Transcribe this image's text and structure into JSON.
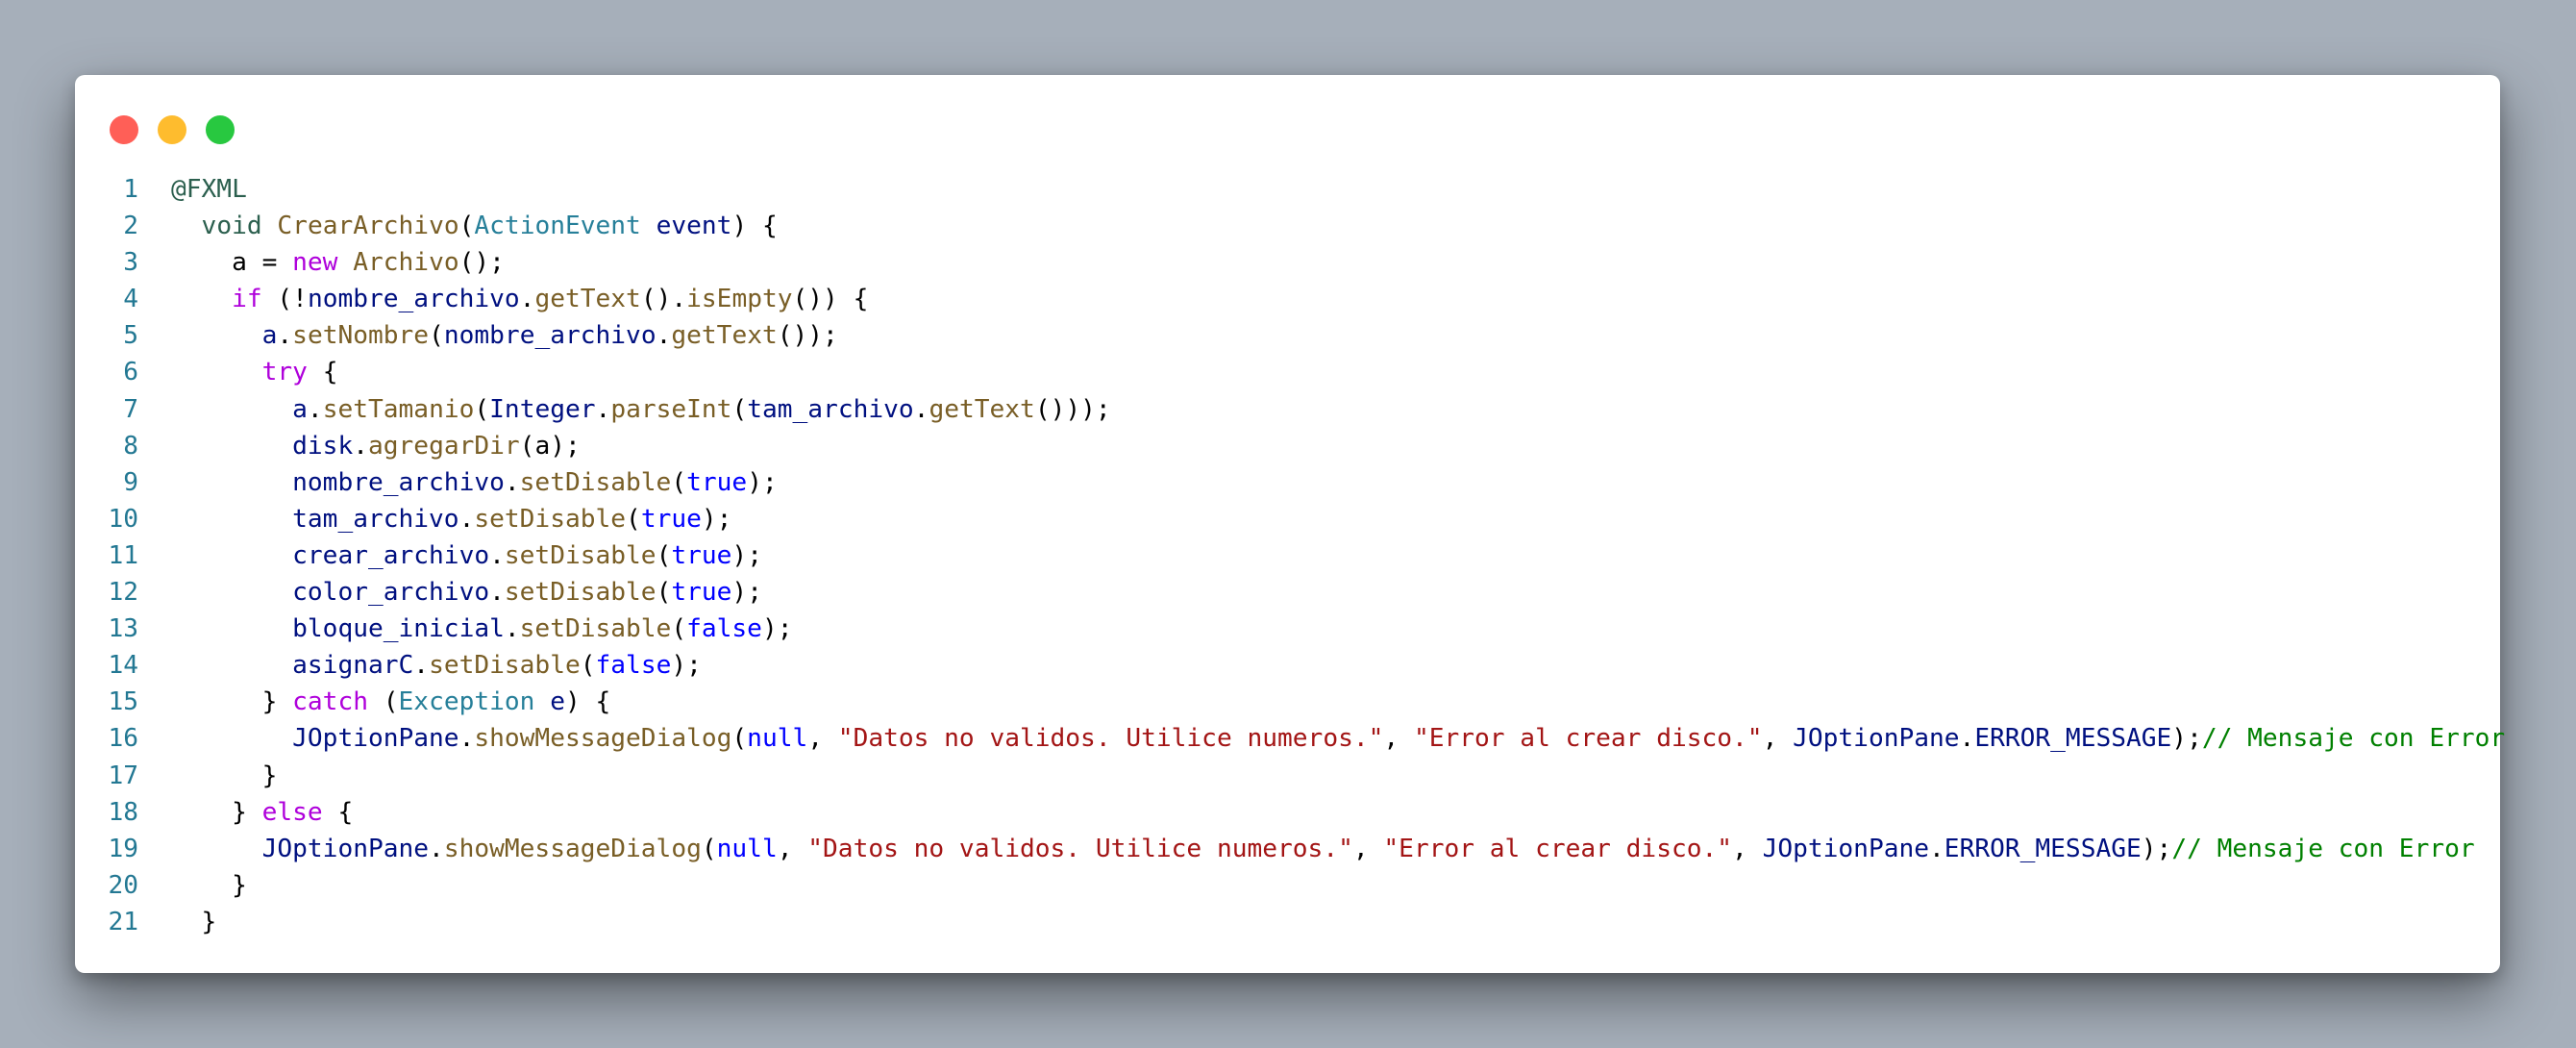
{
  "window": {
    "controls": [
      {
        "name": "close",
        "color": "#ff5f57"
      },
      {
        "name": "minimize",
        "color": "#febc2e"
      },
      {
        "name": "maximize",
        "color": "#28c840"
      }
    ]
  },
  "colors": {
    "annotation": "#2b5f4e",
    "keyword": "#0000ff",
    "control": "#af00db",
    "type": "#267f99",
    "function": "#795e26",
    "variable": "#001080",
    "string": "#a31515",
    "comment": "#008000",
    "line_number": "#237893"
  },
  "code": {
    "lines": [
      {
        "n": "1",
        "tokens": [
          [
            "ann",
            "@FXML"
          ]
        ]
      },
      {
        "n": "2",
        "tokens": [
          [
            "plain",
            "  "
          ],
          [
            "ann",
            "void"
          ],
          [
            "plain",
            " "
          ],
          [
            "fn",
            "CrearArchivo"
          ],
          [
            "plain",
            "("
          ],
          [
            "type",
            "ActionEvent"
          ],
          [
            "plain",
            " "
          ],
          [
            "var",
            "event"
          ],
          [
            "plain",
            ") {"
          ]
        ]
      },
      {
        "n": "3",
        "tokens": [
          [
            "plain",
            "    a = "
          ],
          [
            "ctl",
            "new"
          ],
          [
            "plain",
            " "
          ],
          [
            "fn",
            "Archivo"
          ],
          [
            "plain",
            "();"
          ]
        ]
      },
      {
        "n": "4",
        "tokens": [
          [
            "plain",
            "    "
          ],
          [
            "ctl",
            "if"
          ],
          [
            "plain",
            " (!"
          ],
          [
            "var",
            "nombre_archivo"
          ],
          [
            "plain",
            "."
          ],
          [
            "fn",
            "getText"
          ],
          [
            "plain",
            "()."
          ],
          [
            "fn",
            "isEmpty"
          ],
          [
            "plain",
            "()) {"
          ]
        ]
      },
      {
        "n": "5",
        "tokens": [
          [
            "plain",
            "      "
          ],
          [
            "var",
            "a"
          ],
          [
            "plain",
            "."
          ],
          [
            "fn",
            "setNombre"
          ],
          [
            "plain",
            "("
          ],
          [
            "var",
            "nombre_archivo"
          ],
          [
            "plain",
            "."
          ],
          [
            "fn",
            "getText"
          ],
          [
            "plain",
            "());"
          ]
        ]
      },
      {
        "n": "6",
        "tokens": [
          [
            "plain",
            "      "
          ],
          [
            "ctl",
            "try"
          ],
          [
            "plain",
            " {"
          ]
        ]
      },
      {
        "n": "7",
        "tokens": [
          [
            "plain",
            "        "
          ],
          [
            "var",
            "a"
          ],
          [
            "plain",
            "."
          ],
          [
            "fn",
            "setTamanio"
          ],
          [
            "plain",
            "("
          ],
          [
            "var",
            "Integer"
          ],
          [
            "plain",
            "."
          ],
          [
            "fn",
            "parseInt"
          ],
          [
            "plain",
            "("
          ],
          [
            "var",
            "tam_archivo"
          ],
          [
            "plain",
            "."
          ],
          [
            "fn",
            "getText"
          ],
          [
            "plain",
            "()));"
          ]
        ]
      },
      {
        "n": "8",
        "tokens": [
          [
            "plain",
            "        "
          ],
          [
            "var",
            "disk"
          ],
          [
            "plain",
            "."
          ],
          [
            "fn",
            "agregarDir"
          ],
          [
            "plain",
            "(a);"
          ]
        ]
      },
      {
        "n": "9",
        "tokens": [
          [
            "plain",
            "        "
          ],
          [
            "var",
            "nombre_archivo"
          ],
          [
            "plain",
            "."
          ],
          [
            "fn",
            "setDisable"
          ],
          [
            "plain",
            "("
          ],
          [
            "kw",
            "true"
          ],
          [
            "plain",
            ");"
          ]
        ]
      },
      {
        "n": "10",
        "tokens": [
          [
            "plain",
            "        "
          ],
          [
            "var",
            "tam_archivo"
          ],
          [
            "plain",
            "."
          ],
          [
            "fn",
            "setDisable"
          ],
          [
            "plain",
            "("
          ],
          [
            "kw",
            "true"
          ],
          [
            "plain",
            ");"
          ]
        ]
      },
      {
        "n": "11",
        "tokens": [
          [
            "plain",
            "        "
          ],
          [
            "var",
            "crear_archivo"
          ],
          [
            "plain",
            "."
          ],
          [
            "fn",
            "setDisable"
          ],
          [
            "plain",
            "("
          ],
          [
            "kw",
            "true"
          ],
          [
            "plain",
            ");"
          ]
        ]
      },
      {
        "n": "12",
        "tokens": [
          [
            "plain",
            "        "
          ],
          [
            "var",
            "color_archivo"
          ],
          [
            "plain",
            "."
          ],
          [
            "fn",
            "setDisable"
          ],
          [
            "plain",
            "("
          ],
          [
            "kw",
            "true"
          ],
          [
            "plain",
            ");"
          ]
        ]
      },
      {
        "n": "13",
        "tokens": [
          [
            "plain",
            "        "
          ],
          [
            "var",
            "bloque_inicial"
          ],
          [
            "plain",
            "."
          ],
          [
            "fn",
            "setDisable"
          ],
          [
            "plain",
            "("
          ],
          [
            "kw",
            "false"
          ],
          [
            "plain",
            ");"
          ]
        ]
      },
      {
        "n": "14",
        "tokens": [
          [
            "plain",
            "        "
          ],
          [
            "var",
            "asignarC"
          ],
          [
            "plain",
            "."
          ],
          [
            "fn",
            "setDisable"
          ],
          [
            "plain",
            "("
          ],
          [
            "kw",
            "false"
          ],
          [
            "plain",
            ");"
          ]
        ]
      },
      {
        "n": "15",
        "tokens": [
          [
            "plain",
            "      } "
          ],
          [
            "ctl",
            "catch"
          ],
          [
            "plain",
            " ("
          ],
          [
            "type",
            "Exception"
          ],
          [
            "plain",
            " "
          ],
          [
            "var",
            "e"
          ],
          [
            "plain",
            ") {"
          ]
        ]
      },
      {
        "n": "16",
        "tokens": [
          [
            "plain",
            "        "
          ],
          [
            "var",
            "JOptionPane"
          ],
          [
            "plain",
            "."
          ],
          [
            "fn",
            "showMessageDialog"
          ],
          [
            "plain",
            "("
          ],
          [
            "kw",
            "null"
          ],
          [
            "plain",
            ", "
          ],
          [
            "str",
            "\"Datos no validos. Utilice numeros.\""
          ],
          [
            "plain",
            ", "
          ],
          [
            "str",
            "\"Error al crear disco.\""
          ],
          [
            "plain",
            ", "
          ],
          [
            "var",
            "JOptionPane"
          ],
          [
            "plain",
            "."
          ],
          [
            "var",
            "ERROR_MESSAGE"
          ],
          [
            "plain",
            ");"
          ],
          [
            "com",
            "// Mensaje con Error"
          ]
        ]
      },
      {
        "n": "17",
        "tokens": [
          [
            "plain",
            "      }"
          ]
        ]
      },
      {
        "n": "18",
        "tokens": [
          [
            "plain",
            "    } "
          ],
          [
            "ctl",
            "else"
          ],
          [
            "plain",
            " {"
          ]
        ]
      },
      {
        "n": "19",
        "tokens": [
          [
            "plain",
            "      "
          ],
          [
            "var",
            "JOptionPane"
          ],
          [
            "plain",
            "."
          ],
          [
            "fn",
            "showMessageDialog"
          ],
          [
            "plain",
            "("
          ],
          [
            "kw",
            "null"
          ],
          [
            "plain",
            ", "
          ],
          [
            "str",
            "\"Datos no validos. Utilice numeros.\""
          ],
          [
            "plain",
            ", "
          ],
          [
            "str",
            "\"Error al crear disco.\""
          ],
          [
            "plain",
            ", "
          ],
          [
            "var",
            "JOptionPane"
          ],
          [
            "plain",
            "."
          ],
          [
            "var",
            "ERROR_MESSAGE"
          ],
          [
            "plain",
            ");"
          ],
          [
            "com",
            "// Mensaje con Error"
          ]
        ]
      },
      {
        "n": "20",
        "tokens": [
          [
            "plain",
            "    }"
          ]
        ]
      },
      {
        "n": "21",
        "tokens": [
          [
            "plain",
            "  }"
          ]
        ]
      }
    ]
  }
}
